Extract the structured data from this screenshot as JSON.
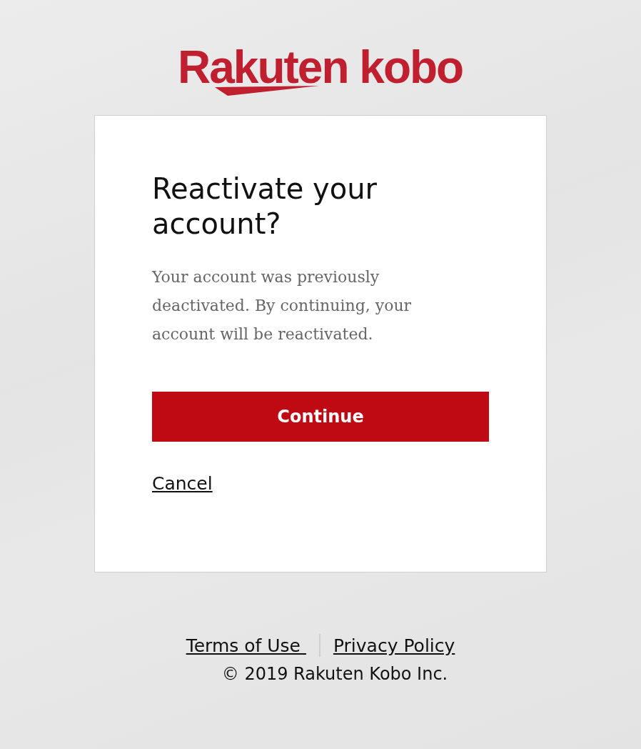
{
  "logo": {
    "text": "Rakuten kobo"
  },
  "dialog": {
    "title": "Reactivate your account?",
    "message": "Your account was previously deactivated. By continuing, your account will be reactivated.",
    "primary_button": "Continue",
    "cancel_link": "Cancel"
  },
  "footer": {
    "links": [
      "Terms of Use ",
      "Privacy Policy"
    ],
    "copyright": "© 2019 Rakuten Kobo Inc."
  }
}
